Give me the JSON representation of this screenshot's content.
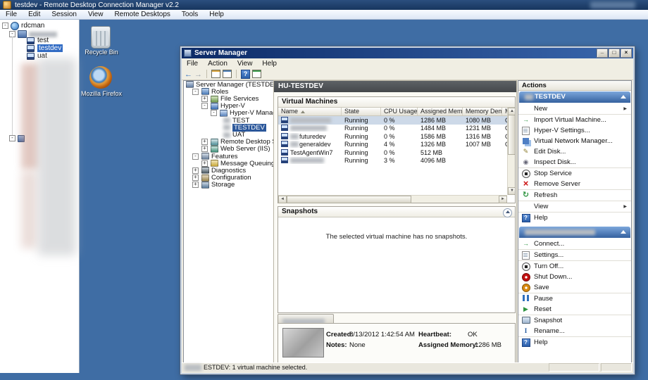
{
  "colors": {
    "desktop": "#3f6da4",
    "selection_blue": "#2f6ac4",
    "sm_titlebar_navy": "#0c2a66",
    "action_header_blue": "#35619f",
    "content_header_gray": "#4f5357"
  },
  "rdcman": {
    "title": "testdev - Remote Desktop Connection Manager v2.2",
    "menus": [
      "File",
      "Edit",
      "Session",
      "View",
      "Remote Desktops",
      "Tools",
      "Help"
    ],
    "tree": {
      "root": "rdcman",
      "items": [
        "test",
        "testdev",
        "uat"
      ],
      "selected": "testdev"
    }
  },
  "desktop": {
    "icons": [
      {
        "label": "Recycle Bin"
      },
      {
        "label": "Mozilla Firefox"
      }
    ]
  },
  "server_manager": {
    "title": "Server Manager",
    "menus": [
      "File",
      "Action",
      "View",
      "Help"
    ],
    "tree": {
      "root_prefix": "Server Manager (",
      "root_suffix": "TESTDEV)",
      "items": [
        "Roles",
        "File Services",
        "Hyper-V",
        "Hyper-V Manager",
        "TEST",
        "TESTDEV",
        "UAT",
        "Remote Desktop Services",
        "Web Server (IIS)",
        "Features",
        "Message Queuing",
        "Diagnostics",
        "Configuration",
        "Storage"
      ]
    },
    "content_header": "HU-TESTDEV",
    "vm_panel": {
      "title": "Virtual Machines",
      "columns": [
        "Name",
        "State",
        "CPU Usage",
        "Assigned Memory",
        "Memory Demand",
        "M"
      ],
      "rows": [
        {
          "name": "",
          "state": "Running",
          "cpu": "0 %",
          "assigned": "1286 MB",
          "demand": "1080 MB",
          "mem_status": "O",
          "selected": true,
          "name_redacted": true
        },
        {
          "name": "",
          "state": "Running",
          "cpu": "0 %",
          "assigned": "1484 MB",
          "demand": "1231 MB",
          "mem_status": "O",
          "name_redacted": true
        },
        {
          "name": "futuredev",
          "state": "Running",
          "cpu": "0 %",
          "assigned": "1586 MB",
          "demand": "1316 MB",
          "mem_status": "O",
          "name_prefix_redacted": true
        },
        {
          "name": "generaldev",
          "state": "Running",
          "cpu": "4 %",
          "assigned": "1326 MB",
          "demand": "1007 MB",
          "mem_status": "O",
          "name_prefix_redacted": true
        },
        {
          "name": "TestAgentWin7",
          "state": "Running",
          "cpu": "0 %",
          "assigned": "512 MB",
          "demand": "",
          "mem_status": ""
        },
        {
          "name": "",
          "state": "Running",
          "cpu": "3 %",
          "assigned": "4096 MB",
          "demand": "",
          "mem_status": "",
          "name_redacted": true
        }
      ]
    },
    "snapshots": {
      "title": "Snapshots",
      "empty_message": "The selected virtual machine has no snapshots."
    },
    "details": {
      "created_label": "Created:",
      "created_value": "8/13/2012 1:42:54 AM",
      "notes_label": "Notes:",
      "notes_value": "None",
      "heartbeat_label": "Heartbeat:",
      "heartbeat_value": "OK",
      "assigned_label": "Assigned Memory:",
      "assigned_value": "1286 MB"
    },
    "status_bar": "ESTDEV:  1 virtual machine selected."
  },
  "actions": {
    "title": "Actions",
    "section1": {
      "header": "TESTDEV",
      "items": [
        "New",
        "Import Virtual Machine...",
        "Hyper-V Settings...",
        "Virtual Network Manager...",
        "Edit Disk...",
        "Inspect Disk...",
        "Stop Service",
        "Remove Server",
        "Refresh",
        "View",
        "Help"
      ]
    },
    "section2": {
      "items": [
        "Connect...",
        "Settings...",
        "Turn Off...",
        "Shut Down...",
        "Save",
        "Pause",
        "Reset",
        "Snapshot",
        "Rename...",
        "Help"
      ]
    }
  }
}
